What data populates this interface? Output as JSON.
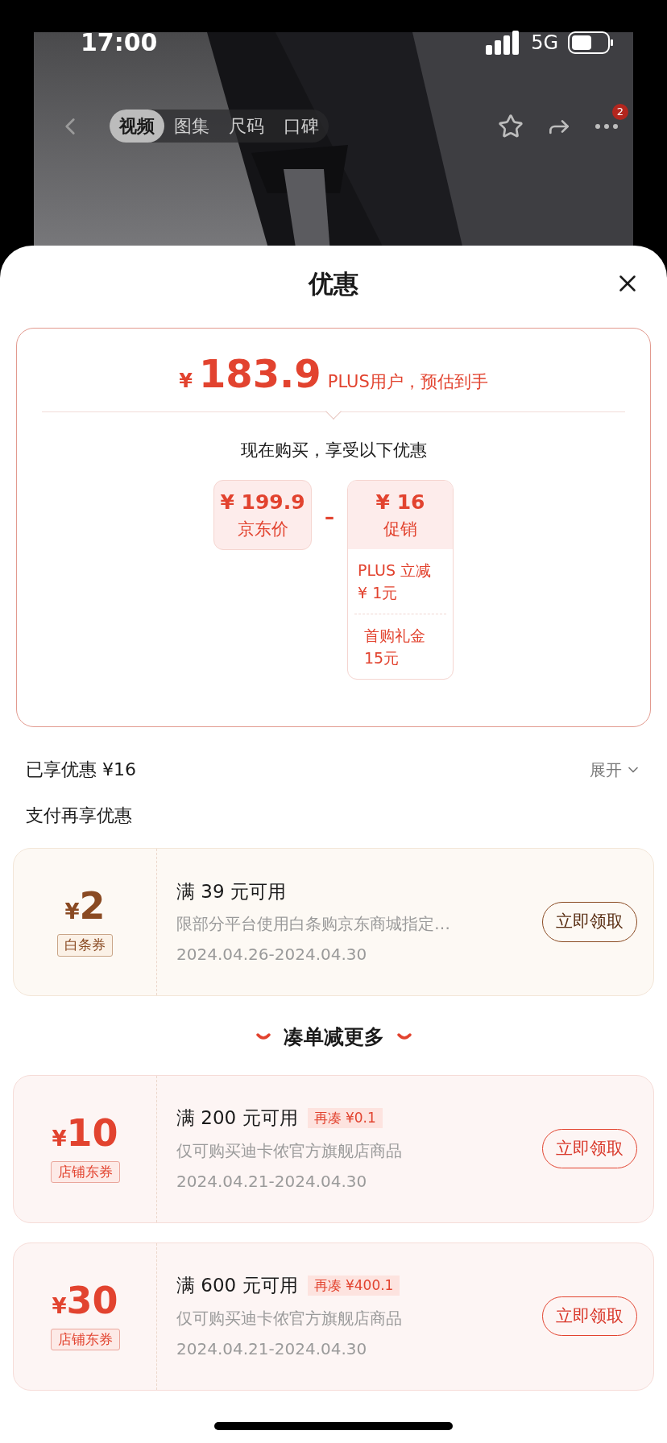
{
  "status_bar": {
    "time": "17:00",
    "network": "5G"
  },
  "nav": {
    "tabs": [
      {
        "label": "视频",
        "selected": true
      },
      {
        "label": "图集",
        "selected": false
      },
      {
        "label": "尺码",
        "selected": false
      },
      {
        "label": "口碑",
        "selected": false
      }
    ],
    "badge": "2"
  },
  "sheet": {
    "title": "优惠"
  },
  "price_card": {
    "currency": "¥",
    "price": "183.9",
    "note": "PLUS用户，预估到手",
    "subtitle": "现在购买，享受以下优惠",
    "base": {
      "amount": "¥ 199.9",
      "label": "京东价"
    },
    "operator": "–",
    "discount": {
      "amount": "¥ 16",
      "label": "促销",
      "items": [
        {
          "lines": [
            "PLUS 立减",
            "¥ 1元"
          ]
        },
        {
          "lines": [
            "首购礼金",
            "15元"
          ]
        }
      ]
    }
  },
  "saved": {
    "label": "已享优惠 ¥16",
    "toggle": "展开"
  },
  "pay_title": "支付再享优惠",
  "coupons": [
    {
      "kind": "baitiao",
      "currency": "¥",
      "amount": "2",
      "tag": "白条券",
      "condition": "满 39 元可用",
      "description": "限部分平台使用白条购京东商城指定…",
      "validity": "2024.04.26-2024.04.30",
      "button": "立即领取"
    }
  ],
  "more_title": "凑单减更多",
  "more_coupons": [
    {
      "kind": "shop",
      "currency": "¥",
      "amount": "10",
      "tag": "店铺东券",
      "condition": "满 200 元可用",
      "extra": "再凑 ¥0.1",
      "description": "仅可购买迪卡侬官方旗舰店商品",
      "validity": "2024.04.21-2024.04.30",
      "button": "立即领取"
    },
    {
      "kind": "shop",
      "currency": "¥",
      "amount": "30",
      "tag": "店铺东券",
      "condition": "满 600 元可用",
      "extra": "再凑 ¥400.1",
      "description": "仅可购买迪卡侬官方旗舰店商品",
      "validity": "2024.04.21-2024.04.30",
      "button": "立即领取"
    }
  ]
}
